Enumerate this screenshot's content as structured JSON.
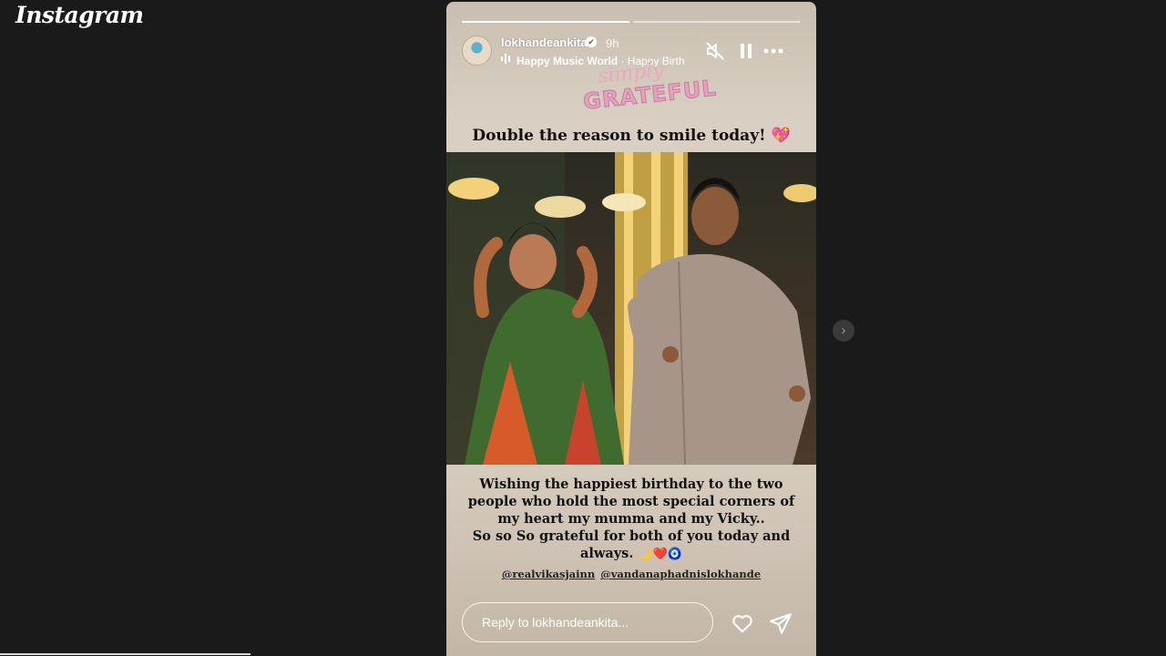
{
  "app": {
    "logo_text": "Instagram"
  },
  "story": {
    "progress": [
      1.0,
      0.0
    ],
    "username": "lokhandeankita",
    "verified_mark": "✔",
    "time_ago": "9h",
    "music": {
      "artist": "Happy Music World",
      "separator": " · ",
      "track": "Happy Birth"
    },
    "controls": {
      "mute": "muted-speaker-icon",
      "pause": "pause-icon",
      "more": "more-options-icon"
    },
    "sticker": {
      "line1": "simply",
      "line2": "GRATEFUL"
    },
    "headline": "Double the reason to smile today!",
    "headline_emoji": "💖",
    "photo_subject": "wedding-photo",
    "caption": [
      "Wishing the happiest birthday to the two",
      "people who hold the most special corners of",
      "my heart my mumma and my Vicky..",
      "So so So grateful for both of you today and",
      "always."
    ],
    "caption_emojis": "🌙❤️🧿",
    "mentions": [
      "@realvikasjainn",
      "@vandanaphadnislokhande"
    ],
    "reply": {
      "placeholder": "Reply to lokhandeankita..."
    },
    "actions": {
      "like": "heart-icon",
      "share": "send-icon"
    }
  },
  "navigation": {
    "next": "›"
  },
  "colors": {
    "page_bg": "#1a1a1a",
    "story_bg": "#d9cfc2",
    "text_dark": "#111111",
    "sticker_pink": "#e7a0bf"
  }
}
